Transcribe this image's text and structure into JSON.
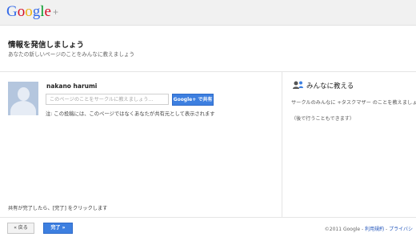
{
  "header": {
    "logo_text": "Google",
    "logo_plus": "+",
    "logo_colors": [
      "#3369e8",
      "#d50f25",
      "#eeb211",
      "#3369e8",
      "#009925",
      "#d50f25"
    ]
  },
  "page": {
    "title": "情報を発信しましょう",
    "subtitle": "あなたの新しいページのことをみんなに教えましょう"
  },
  "share": {
    "user_name": "nakano harumi",
    "input_placeholder": "このページのことをサークルに教えましょう...",
    "input_value": "",
    "share_button_label": "Google+ で共有",
    "note": "注: この投稿には、このページではなくあなたが共有元として表示されます"
  },
  "right_panel": {
    "icon": "share-people-icon",
    "title": "みんなに教える",
    "description": "サークルのみんなに +タスクマザー のことを教えましょう。",
    "later_text": "（後で行うこともできます）"
  },
  "instruction": "共有が完了したら、[完了] をクリックします",
  "footer": {
    "back_label": "« 戻る",
    "done_label": "完了 »",
    "copyright": "©2011 Google - ",
    "terms_link": "利用規約",
    "separator": " - ",
    "privacy_link": "プライバシ"
  },
  "colors": {
    "accent_blue": "#3d7fe0",
    "link_blue": "#2255bb"
  }
}
